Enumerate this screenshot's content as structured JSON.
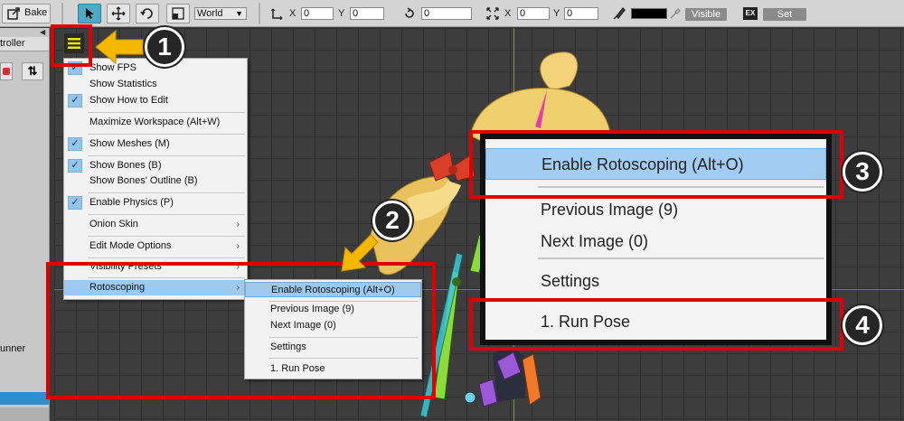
{
  "toolbar": {
    "bake_label": "Bake",
    "coord_space": "World",
    "pos_x_label": "X",
    "pos_x_value": "0",
    "pos_y_label": "Y",
    "pos_y_value": "0",
    "rotation_value": "0",
    "scale_x_label": "X",
    "scale_x_value": "0",
    "scale_y_label": "Y",
    "scale_y_value": "0",
    "visible_label": "Visible",
    "ex_label": "EX",
    "set_label": "Set"
  },
  "left_panel": {
    "tab_label": "troller",
    "item_label": "unner"
  },
  "menu": {
    "items": [
      {
        "label": "Show FPS",
        "checked": true
      },
      {
        "label": "Show Statistics",
        "checked": false
      },
      {
        "label": "Show How to Edit",
        "checked": true
      },
      {
        "label": "Maximize Workspace (Alt+W)",
        "checked": false
      },
      {
        "label": "Show Meshes (M)",
        "checked": true
      },
      {
        "label": "Show Bones (B)",
        "checked": true
      },
      {
        "label": "Show Bones' Outline (B)",
        "checked": false
      },
      {
        "label": "Enable Physics (P)",
        "checked": true
      },
      {
        "label": "Onion Skin",
        "checked": false
      },
      {
        "label": "Edit Mode Options",
        "checked": false
      },
      {
        "label": "Visibility Presets",
        "checked": false
      },
      {
        "label": "Rotoscoping",
        "checked": false
      }
    ],
    "submenu_arrow": "›"
  },
  "submenu": {
    "items": [
      {
        "label": "Enable Rotoscoping (Alt+O)"
      },
      {
        "label": "Previous Image (9)"
      },
      {
        "label": "Next Image (0)"
      },
      {
        "label": "Settings"
      },
      {
        "label": "1. Run Pose"
      }
    ]
  },
  "zoom": {
    "items": [
      {
        "label": "Enable Rotoscoping (Alt+O)"
      },
      {
        "label": "Previous Image (9)"
      },
      {
        "label": "Next Image (0)"
      },
      {
        "label": "Settings"
      },
      {
        "label": "1. Run Pose"
      }
    ]
  },
  "annotations": [
    "1",
    "2",
    "3",
    "4"
  ],
  "icons": {
    "menu": "hamburger-icon",
    "select": "cursor-icon",
    "move": "move-icon",
    "rotate": "rotate-icon",
    "scale": "scale-icon",
    "bake": "export-icon"
  },
  "colors": {
    "annotation_red": "#e00000",
    "arrow_yellow": "#f5b800",
    "highlight_blue": "#9ec9ef",
    "active_tool": "#4fa8c4"
  }
}
